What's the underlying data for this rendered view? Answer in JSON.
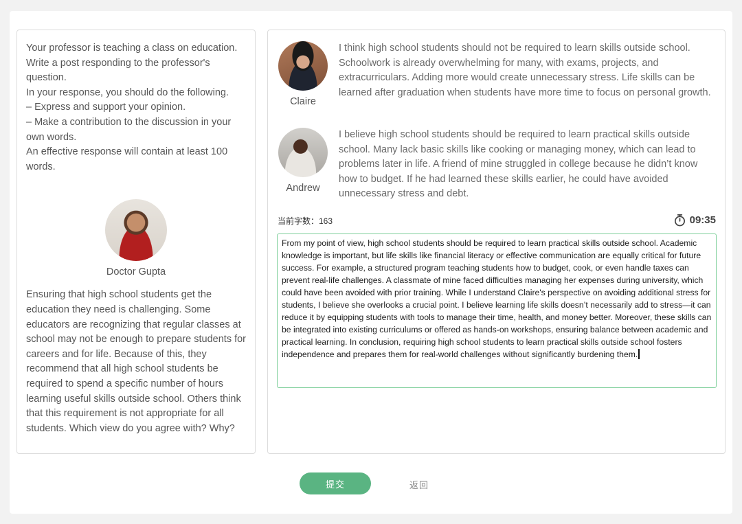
{
  "task": {
    "lines": [
      "Your professor is teaching a class on education. Write a post responding to the professor's question.",
      "In your response, you should do the following.",
      "– Express and support your opinion.",
      "– Make a contribution to the discussion in your own words.",
      "An effective response will contain at least 100 words."
    ]
  },
  "professor": {
    "name": "Doctor Gupta",
    "question": "Ensuring that high school students get the education they need is challenging. Some educators are recognizing that regular classes at school may not be enough to prepare students for careers and for life. Because of this, they recommend that all high school students be required to spend a specific number of hours learning useful skills outside school. Others think that this requirement is not appropriate for all students. Which view do you agree with? Why?"
  },
  "posts": [
    {
      "name": "Claire",
      "text": "I think high school students should not be required to learn skills outside school. Schoolwork is already overwhelming for many, with exams, projects, and extracurriculars. Adding more would create unnecessary stress. Life skills can be learned after graduation when students have more time to focus on personal growth."
    },
    {
      "name": "Andrew",
      "text": "I believe high school students should be required to learn practical skills outside school. Many lack basic skills like cooking or managing money, which can lead to problems later in life. A friend of mine struggled in college because he didn’t know how to budget. If he had learned these skills earlier, he could have avoided unnecessary stress and debt."
    }
  ],
  "editor": {
    "word_count_label": "当前字数：163",
    "timer": "09:35",
    "response": "From my point of view, high school students should be required to learn practical skills outside school. Academic knowledge is important, but life skills like financial literacy or effective communication are equally critical for future success. For example, a structured program teaching students how to budget, cook, or even handle taxes can prevent real-life challenges. A classmate of mine faced difficulties managing her expenses during university, which could have been avoided with prior training. While I understand Claire's perspective on avoiding additional stress for students, I believe she overlooks a crucial point. I believe learning life skills doesn’t necessarily add to stress—it can reduce it by equipping students with tools to manage their time, health, and money better. Moreover, these skills can be integrated into existing curriculums or offered as hands-on workshops, ensuring balance between academic and practical learning. In conclusion, requiring high school students to learn practical skills outside school fosters independence and prepares them for real-world challenges without significantly burdening them."
  },
  "actions": {
    "submit_label": "提交",
    "back_label": "返回"
  },
  "colors": {
    "accent": "#5ab482",
    "editor_border": "#7fcf9b"
  }
}
